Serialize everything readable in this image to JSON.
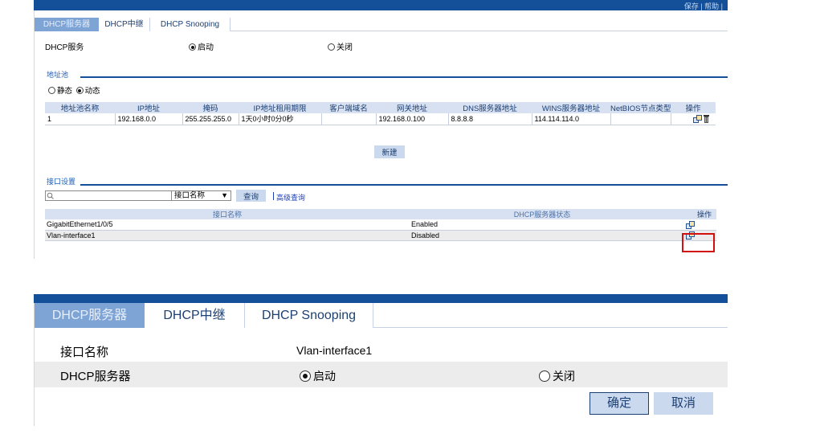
{
  "top": {
    "header_links": "保存 | 帮助 |",
    "tabs": [
      "DHCP服务器",
      "DHCP中继",
      "DHCP Snooping"
    ],
    "dhcp_service": {
      "label": "DHCP服务",
      "on": "启动",
      "off": "关闭"
    },
    "pool_section": {
      "title": "地址池",
      "mode_static": "静态",
      "mode_dynamic": "动态",
      "columns": [
        "地址池名称",
        "IP地址",
        "掩码",
        "IP地址租用期限",
        "客户端域名",
        "网关地址",
        "DNS服务器地址",
        "WINS服务器地址",
        "NetBIOS节点类型",
        "操作"
      ],
      "rows": [
        [
          "1",
          "192.168.0.0",
          "255.255.255.0",
          "1天0小时0分0秒",
          "",
          "192.168.0.100",
          "8.8.8.8",
          "114.114.114.0",
          ""
        ]
      ],
      "new_button": "新建"
    },
    "iface_section": {
      "title": "接口设置",
      "search_placeholder": "",
      "search_field": "接口名称",
      "query_button": "查询",
      "advanced_link": "高级查询",
      "columns": [
        "接口名称",
        "DHCP服务器状态",
        "操作"
      ],
      "rows": [
        {
          "name": "GigabitEthernet1/0/5",
          "status": "Enabled"
        },
        {
          "name": "Vlan-interface1",
          "status": "Disabled"
        }
      ]
    }
  },
  "bottom": {
    "tabs": [
      "DHCP服务器",
      "DHCP中继",
      "DHCP Snooping"
    ],
    "iface_label": "接口名称",
    "iface_value": "Vlan-interface1",
    "server_label": "DHCP服务器",
    "on": "启动",
    "off": "关闭",
    "ok_button": "确定",
    "cancel_button": "取消"
  },
  "colors": {
    "brand_bar": "#14509a",
    "active_tab": "#7ea4d6",
    "highlight": "#d21010"
  }
}
